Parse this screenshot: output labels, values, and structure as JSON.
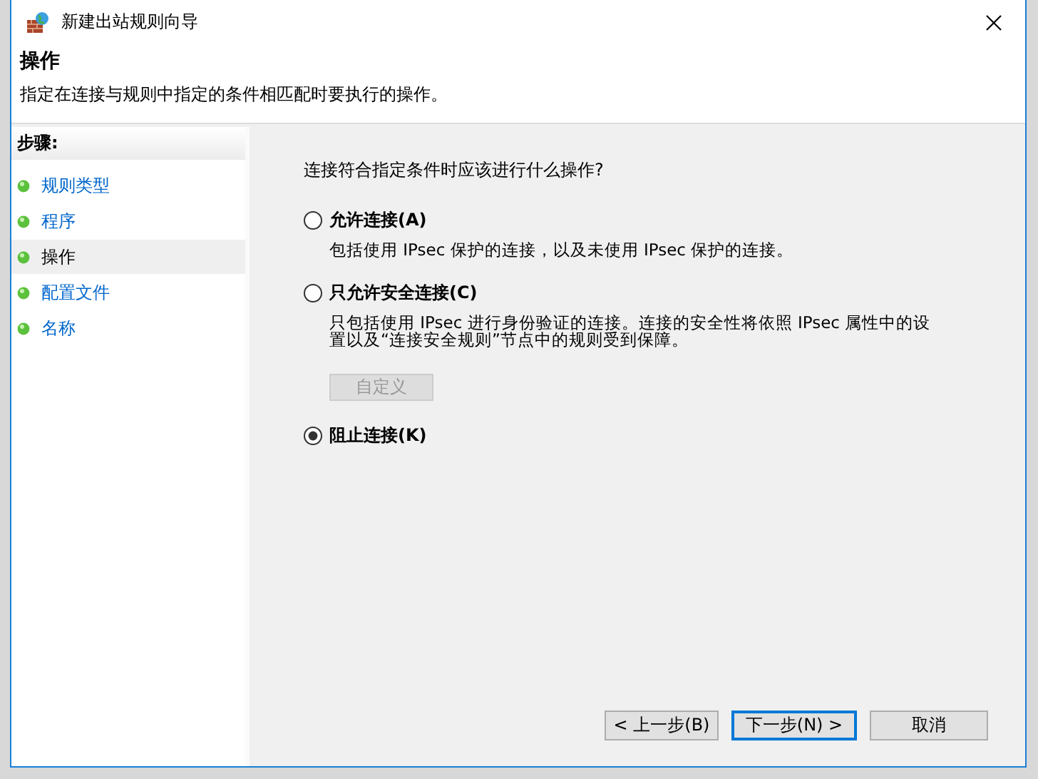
{
  "window": {
    "title": "新建出站规则向导"
  },
  "header": {
    "title": "操作",
    "description": "指定在连接与规则中指定的条件相匹配时要执行的操作。"
  },
  "steps": {
    "title": "步骤:",
    "items": [
      {
        "label": "规则类型",
        "selected": false
      },
      {
        "label": "程序",
        "selected": false
      },
      {
        "label": "操作",
        "selected": true
      },
      {
        "label": "配置文件",
        "selected": false
      },
      {
        "label": "名称",
        "selected": false
      }
    ]
  },
  "question": "连接符合指定条件时应该进行什么操作?",
  "options": [
    {
      "label": "允许连接(A)",
      "selected": false,
      "description": "包括使用 IPsec 保护的连接，以及未使用 IPsec 保护的连接。"
    },
    {
      "label": "只允许安全连接(C)",
      "selected": false,
      "description": "只包括使用 IPsec 进行身份验证的连接。连接的安全性将依照 IPsec 属性中的设置以及“连接安全规则”节点中的规则受到保障。",
      "button": {
        "label": "自定义",
        "disabled": true
      }
    },
    {
      "label": "阻止连接(K)",
      "selected": true
    }
  ],
  "buttons": [
    {
      "label": "< 上一步(B)",
      "default": false
    },
    {
      "label": "下一步(N) >",
      "default": true
    },
    {
      "label": "取消",
      "default": false
    }
  ]
}
